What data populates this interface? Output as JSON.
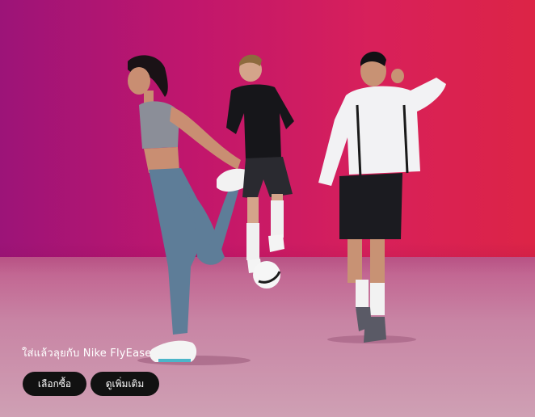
{
  "hero": {
    "caption": "ใส่แล้วลุยกับ Nike FlyEase",
    "colors": {
      "gradient_left": "#9c1478",
      "gradient_right": "#dc2446",
      "floor": "#c884a4",
      "button_bg": "#111111",
      "button_text": "#ffffff"
    }
  },
  "buttons": {
    "shop_label": "เลือกซื้อ",
    "learn_more_label": "ดูเพิ่มเติม"
  }
}
